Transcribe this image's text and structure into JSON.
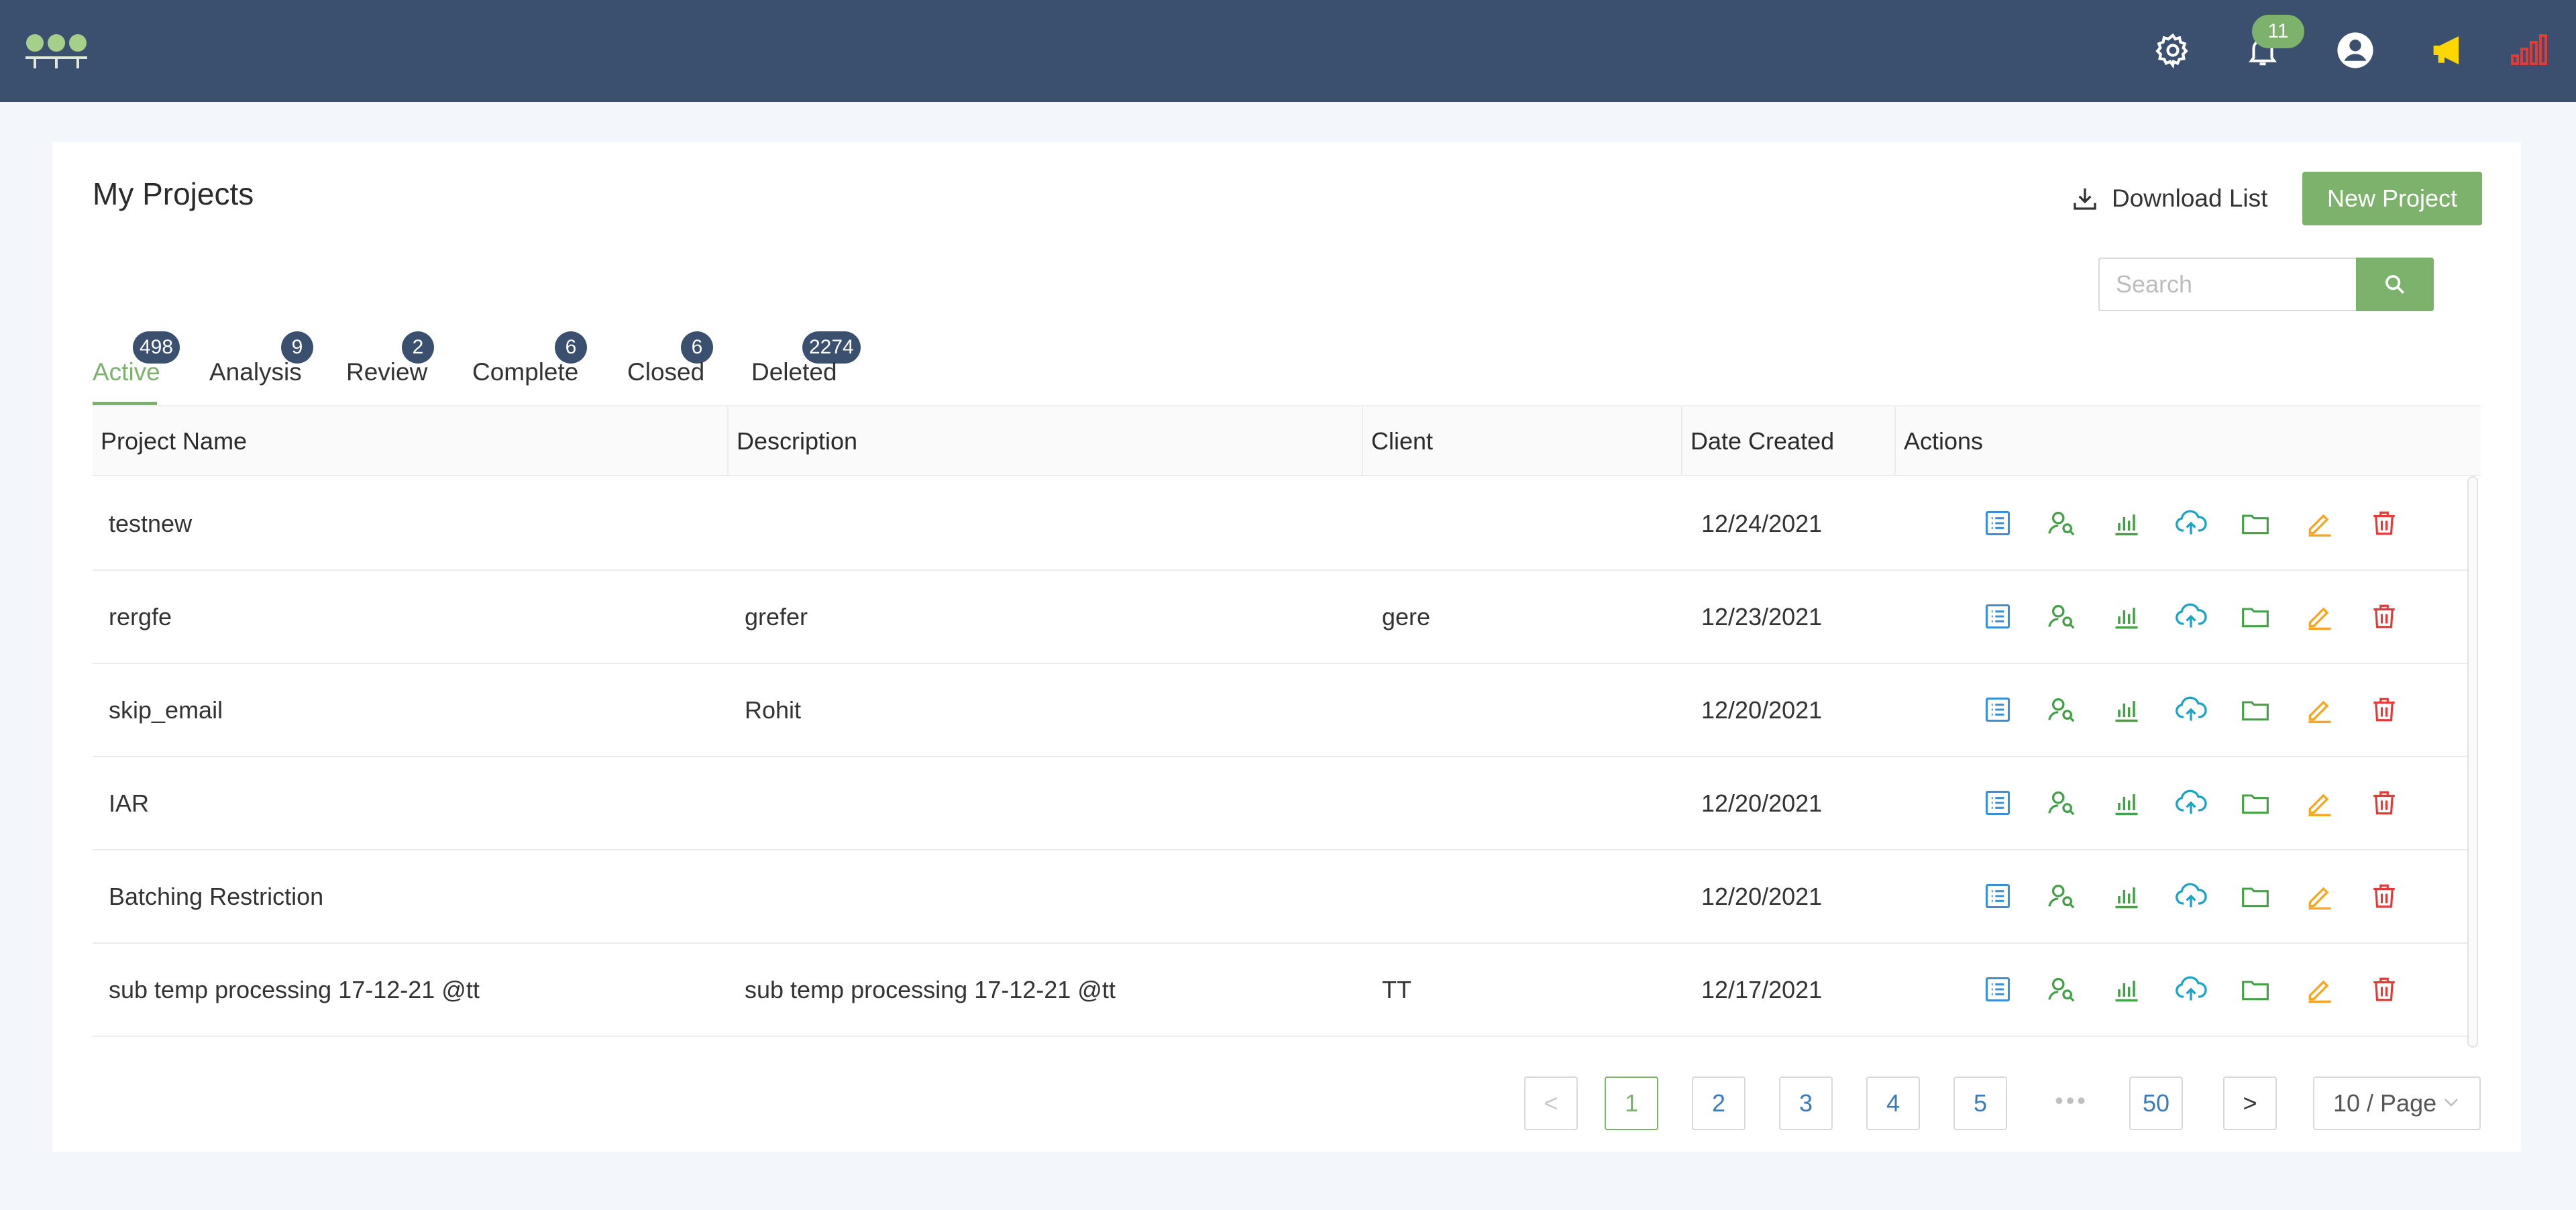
{
  "header": {
    "notification_count": "11",
    "colors": {
      "bar": "#3b506e",
      "accent": "#7cb26b",
      "megaphone": "#ffd700",
      "signal": "#e53935"
    },
    "icons": [
      "logo-icon",
      "gear-icon",
      "bell-icon",
      "user-circle-icon",
      "megaphone-icon",
      "signal-bars-icon"
    ]
  },
  "page": {
    "title": "My Projects",
    "download_label": "Download List",
    "new_project_label": "New Project",
    "search_placeholder": "Search"
  },
  "tabs": [
    {
      "label": "Active",
      "count": "498",
      "active": true
    },
    {
      "label": "Analysis",
      "count": "9"
    },
    {
      "label": "Review",
      "count": "2"
    },
    {
      "label": "Complete",
      "count": "6"
    },
    {
      "label": "Closed",
      "count": "6"
    },
    {
      "label": "Deleted",
      "count": "2274"
    }
  ],
  "table": {
    "columns": [
      "Project Name",
      "Description",
      "Client",
      "Date Created",
      "Actions"
    ],
    "rows": [
      {
        "name": "testnew",
        "description": "",
        "client": "",
        "date": "12/24/2021"
      },
      {
        "name": "rergfe",
        "description": "grefer",
        "client": "gere",
        "date": "12/23/2021"
      },
      {
        "name": "skip_email",
        "description": "Rohit",
        "client": "",
        "date": "12/20/2021"
      },
      {
        "name": "IAR",
        "description": "",
        "client": "",
        "date": "12/20/2021"
      },
      {
        "name": "Batching Restriction",
        "description": "",
        "client": "",
        "date": "12/20/2021"
      },
      {
        "name": "sub temp processing 17-12-21 @tt",
        "description": "sub temp processing 17-12-21 @tt",
        "client": "TT",
        "date": "12/17/2021"
      }
    ],
    "action_icons": [
      "list-details-icon",
      "user-search-icon",
      "bar-chart-icon",
      "cloud-upload-icon",
      "folder-icon",
      "edit-pencil-icon",
      "trash-icon"
    ]
  },
  "pagination": {
    "prev": "<",
    "pages": [
      "1",
      "2",
      "3",
      "4",
      "5"
    ],
    "ellipsis": "•••",
    "last": "50",
    "next": ">",
    "current": "1",
    "page_size": "10 / Page"
  }
}
